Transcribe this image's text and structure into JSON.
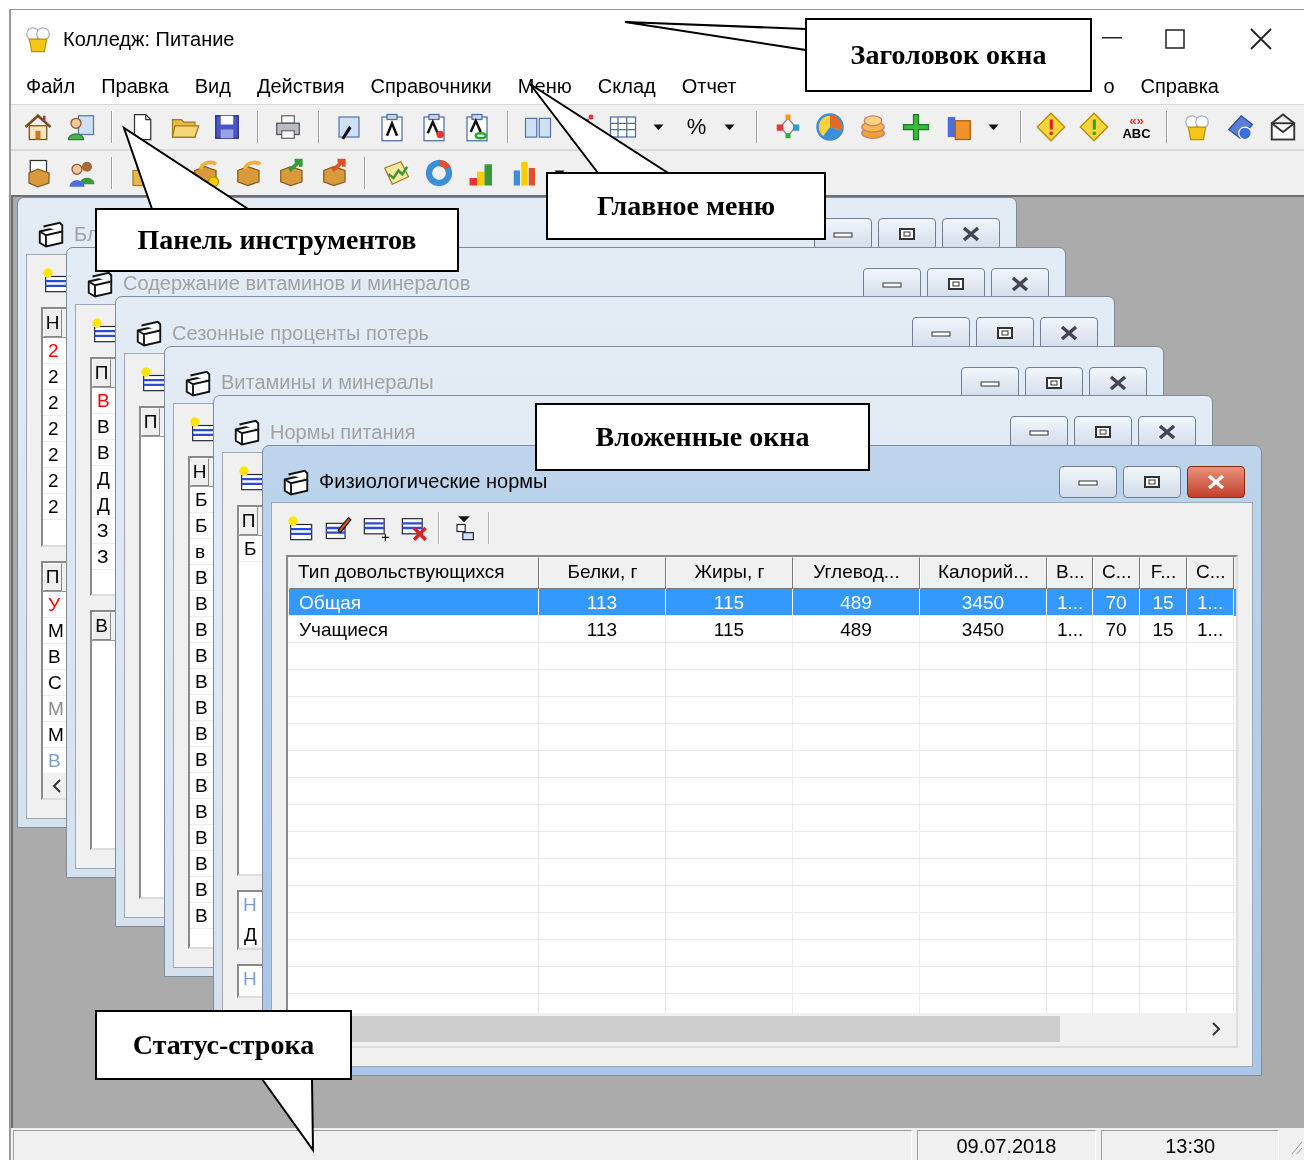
{
  "window": {
    "title": "Колледж: Питание"
  },
  "menu": {
    "left": [
      {
        "label": "Файл"
      },
      {
        "label": "Правка"
      },
      {
        "label": "Вид"
      },
      {
        "label": "Действия"
      },
      {
        "label": "Справочники"
      },
      {
        "label": "Меню"
      },
      {
        "label": "Склад"
      },
      {
        "label": "Отчет"
      }
    ],
    "right": [
      {
        "label": "о"
      },
      {
        "label": "Справка"
      }
    ]
  },
  "toolbar": {
    "percent": "%",
    "spell": {
      "marks": "«»",
      "label": "ABC"
    }
  },
  "child_windows": [
    {
      "title": "Бл",
      "active": false,
      "grids": [
        {
          "header": "Н",
          "hscroll": false,
          "rows": [
            {
              "text": "2",
              "color": "#ff0000"
            },
            {
              "text": "2",
              "color": "#000000"
            },
            {
              "text": "2",
              "color": "#000000"
            },
            {
              "text": "2",
              "color": "#000000"
            },
            {
              "text": "2",
              "color": "#000000"
            },
            {
              "text": "2",
              "color": "#000000"
            },
            {
              "text": "2",
              "color": "#000000"
            }
          ]
        },
        {
          "header": "П",
          "hscroll": true,
          "rows": [
            {
              "text": "У",
              "color": "#ff0000"
            },
            {
              "text": "М",
              "color": "#000000"
            },
            {
              "text": "В",
              "color": "#000000"
            },
            {
              "text": "С",
              "color": "#000000"
            },
            {
              "text": "М",
              "color": "#8c8c8c"
            },
            {
              "text": "М",
              "color": "#000000"
            },
            {
              "text": "В",
              "color": "#7f9fd0"
            }
          ]
        }
      ]
    },
    {
      "title": "Содержание витаминов и минералов",
      "active": false,
      "grids": [
        {
          "header": "П",
          "hscroll": false,
          "rows": [
            {
              "text": "В",
              "color": "#ff0000"
            },
            {
              "text": "В",
              "color": "#000000"
            },
            {
              "text": "В",
              "color": "#000000"
            },
            {
              "text": "Д",
              "color": "#000000"
            },
            {
              "text": "Д",
              "color": "#000000"
            },
            {
              "text": "З",
              "color": "#000000"
            },
            {
              "text": "З",
              "color": "#000000"
            }
          ]
        },
        {
          "header": "В",
          "hscroll": false
        }
      ]
    },
    {
      "title": "Сезонные проценты потерь",
      "active": false,
      "grids": [
        {
          "header": "П",
          "hscroll": false
        }
      ]
    },
    {
      "title": "Витамины и минералы",
      "active": false,
      "grids": [
        {
          "header": "Н",
          "hscroll": false,
          "rows": [
            {
              "text": "Б",
              "color": "#000000"
            },
            {
              "text": "Б",
              "color": "#000000"
            },
            {
              "text": "в",
              "color": "#000000"
            },
            {
              "text": "В",
              "color": "#000000"
            },
            {
              "text": "В",
              "color": "#000000"
            },
            {
              "text": "В",
              "color": "#000000"
            },
            {
              "text": "В",
              "color": "#000000"
            },
            {
              "text": "В",
              "color": "#000000"
            },
            {
              "text": "В",
              "color": "#000000"
            },
            {
              "text": "В",
              "color": "#000000"
            },
            {
              "text": "В",
              "color": "#000000"
            },
            {
              "text": "В",
              "color": "#000000"
            },
            {
              "text": "В",
              "color": "#000000"
            },
            {
              "text": "В",
              "color": "#000000"
            },
            {
              "text": "В",
              "color": "#000000"
            },
            {
              "text": "В",
              "color": "#000000"
            },
            {
              "text": "В",
              "color": "#000000"
            }
          ]
        }
      ]
    },
    {
      "title": "Нормы питания",
      "active": false,
      "grids": [
        {
          "header": "П",
          "hscroll": false,
          "rows": [
            {
              "text": "Б",
              "color": "#000000"
            }
          ]
        },
        {
          "caption": "Н",
          "hscroll": false,
          "rows": [
            {
              "text": "Д",
              "color": "#000000"
            }
          ]
        },
        {
          "caption": "Н",
          "hscroll": false
        }
      ]
    },
    {
      "title": "Физиологические нормы",
      "active": true,
      "table": {
        "columns": [
          "Тип довольствующихся",
          "Белки, г",
          "Жиры, г",
          "Углевод...",
          "Калорий...",
          "В...",
          "С...",
          "F...",
          "С..."
        ],
        "rows": [
          {
            "selected": true,
            "cells": [
              "Общая",
              "113",
              "115",
              "489",
              "3450",
              "1...",
              "70",
              "15",
              "1..."
            ]
          },
          {
            "selected": false,
            "cells": [
              "Учащиеся",
              "113",
              "115",
              "489",
              "3450",
              "1...",
              "70",
              "15",
              "1..."
            ]
          }
        ]
      }
    }
  ],
  "status_bar": {
    "date": "09.07.2018",
    "time": "13:30"
  },
  "callouts": [
    {
      "text": "Заголовок окна"
    },
    {
      "text": "Главное меню"
    },
    {
      "text": "Панель инструментов"
    },
    {
      "text": "Вложенные окна"
    },
    {
      "text": "Статус-строка"
    }
  ]
}
